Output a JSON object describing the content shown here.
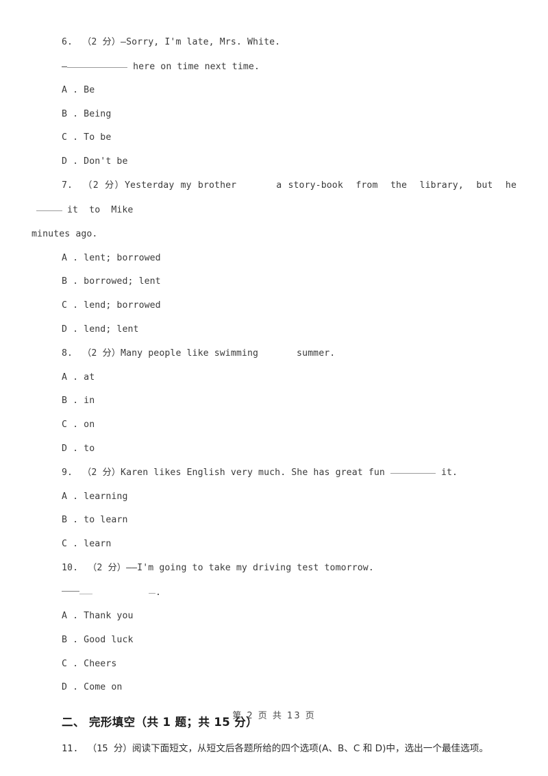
{
  "page": {
    "background_color": "#ffffff",
    "text_color": "#3a3a3a",
    "footer": "第 2 页 共 13 页"
  },
  "questions": [
    {
      "number": "6.",
      "marks": "（2 分）",
      "stem_line1": "—Sorry, I'm late, Mrs. White.",
      "stem_line2_prefix": "—",
      "stem_line2_suffix": " here on time next time.",
      "options": [
        {
          "letter": "A",
          "sep": " . ",
          "text": "Be"
        },
        {
          "letter": "B",
          "sep": " . ",
          "text": "Being"
        },
        {
          "letter": "C",
          "sep": " . ",
          "text": "To be"
        },
        {
          "letter": "D",
          "sep": " . ",
          "text": "Don't be"
        }
      ]
    },
    {
      "number": "7.",
      "marks": "（2 分）",
      "stem_part1": "Yesterday my brother",
      "stem_part2": "a story-book  from  the  library,  but  he",
      "stem_part3": "it  to  Mike",
      "stem_line2": "minutes ago.",
      "options": [
        {
          "letter": "A",
          "sep": " . ",
          "text": "lent; borrowed"
        },
        {
          "letter": "B",
          "sep": " . ",
          "text": "borrowed; lent"
        },
        {
          "letter": "C",
          "sep": " . ",
          "text": "lend; borrowed"
        },
        {
          "letter": "D",
          "sep": " . ",
          "text": "lend; lent"
        }
      ]
    },
    {
      "number": "8.",
      "marks": "（2 分）",
      "stem_part1": "Many people like swimming",
      "stem_part2": "summer.",
      "options": [
        {
          "letter": "A",
          "sep": " . ",
          "text": "at"
        },
        {
          "letter": "B",
          "sep": " . ",
          "text": "in"
        },
        {
          "letter": "C",
          "sep": " . ",
          "text": "on"
        },
        {
          "letter": "D",
          "sep": " . ",
          "text": "to"
        }
      ]
    },
    {
      "number": "9.",
      "marks": "（2 分）",
      "stem_part1": "Karen likes English very much. She has great fun",
      "stem_part2": "it.",
      "options": [
        {
          "letter": "A",
          "sep": " . ",
          "text": "learning"
        },
        {
          "letter": "B",
          "sep": " . ",
          "text": "to learn"
        },
        {
          "letter": "C",
          "sep": " . ",
          "text": "learn"
        }
      ]
    },
    {
      "number": "10.",
      "marks": "（2 分）",
      "stem_line1": "——I'm going to take my driving test tomorrow.",
      "stem_line2_tail": ".",
      "options": [
        {
          "letter": "A",
          "sep": " . ",
          "text": "Thank you"
        },
        {
          "letter": "B",
          "sep": " . ",
          "text": "Good luck"
        },
        {
          "letter": "C",
          "sep": " . ",
          "text": "Cheers"
        },
        {
          "letter": "D",
          "sep": " . ",
          "text": "Come on"
        }
      ]
    }
  ],
  "section": {
    "heading": "二、 完形填空（共 1 题；共 15 分）",
    "question": {
      "number": "11.",
      "marks": "（15 分）",
      "text": "阅读下面短文，从短文后各题所给的四个选项(A、B、C 和 D)中，选出一个最佳选项。"
    }
  }
}
